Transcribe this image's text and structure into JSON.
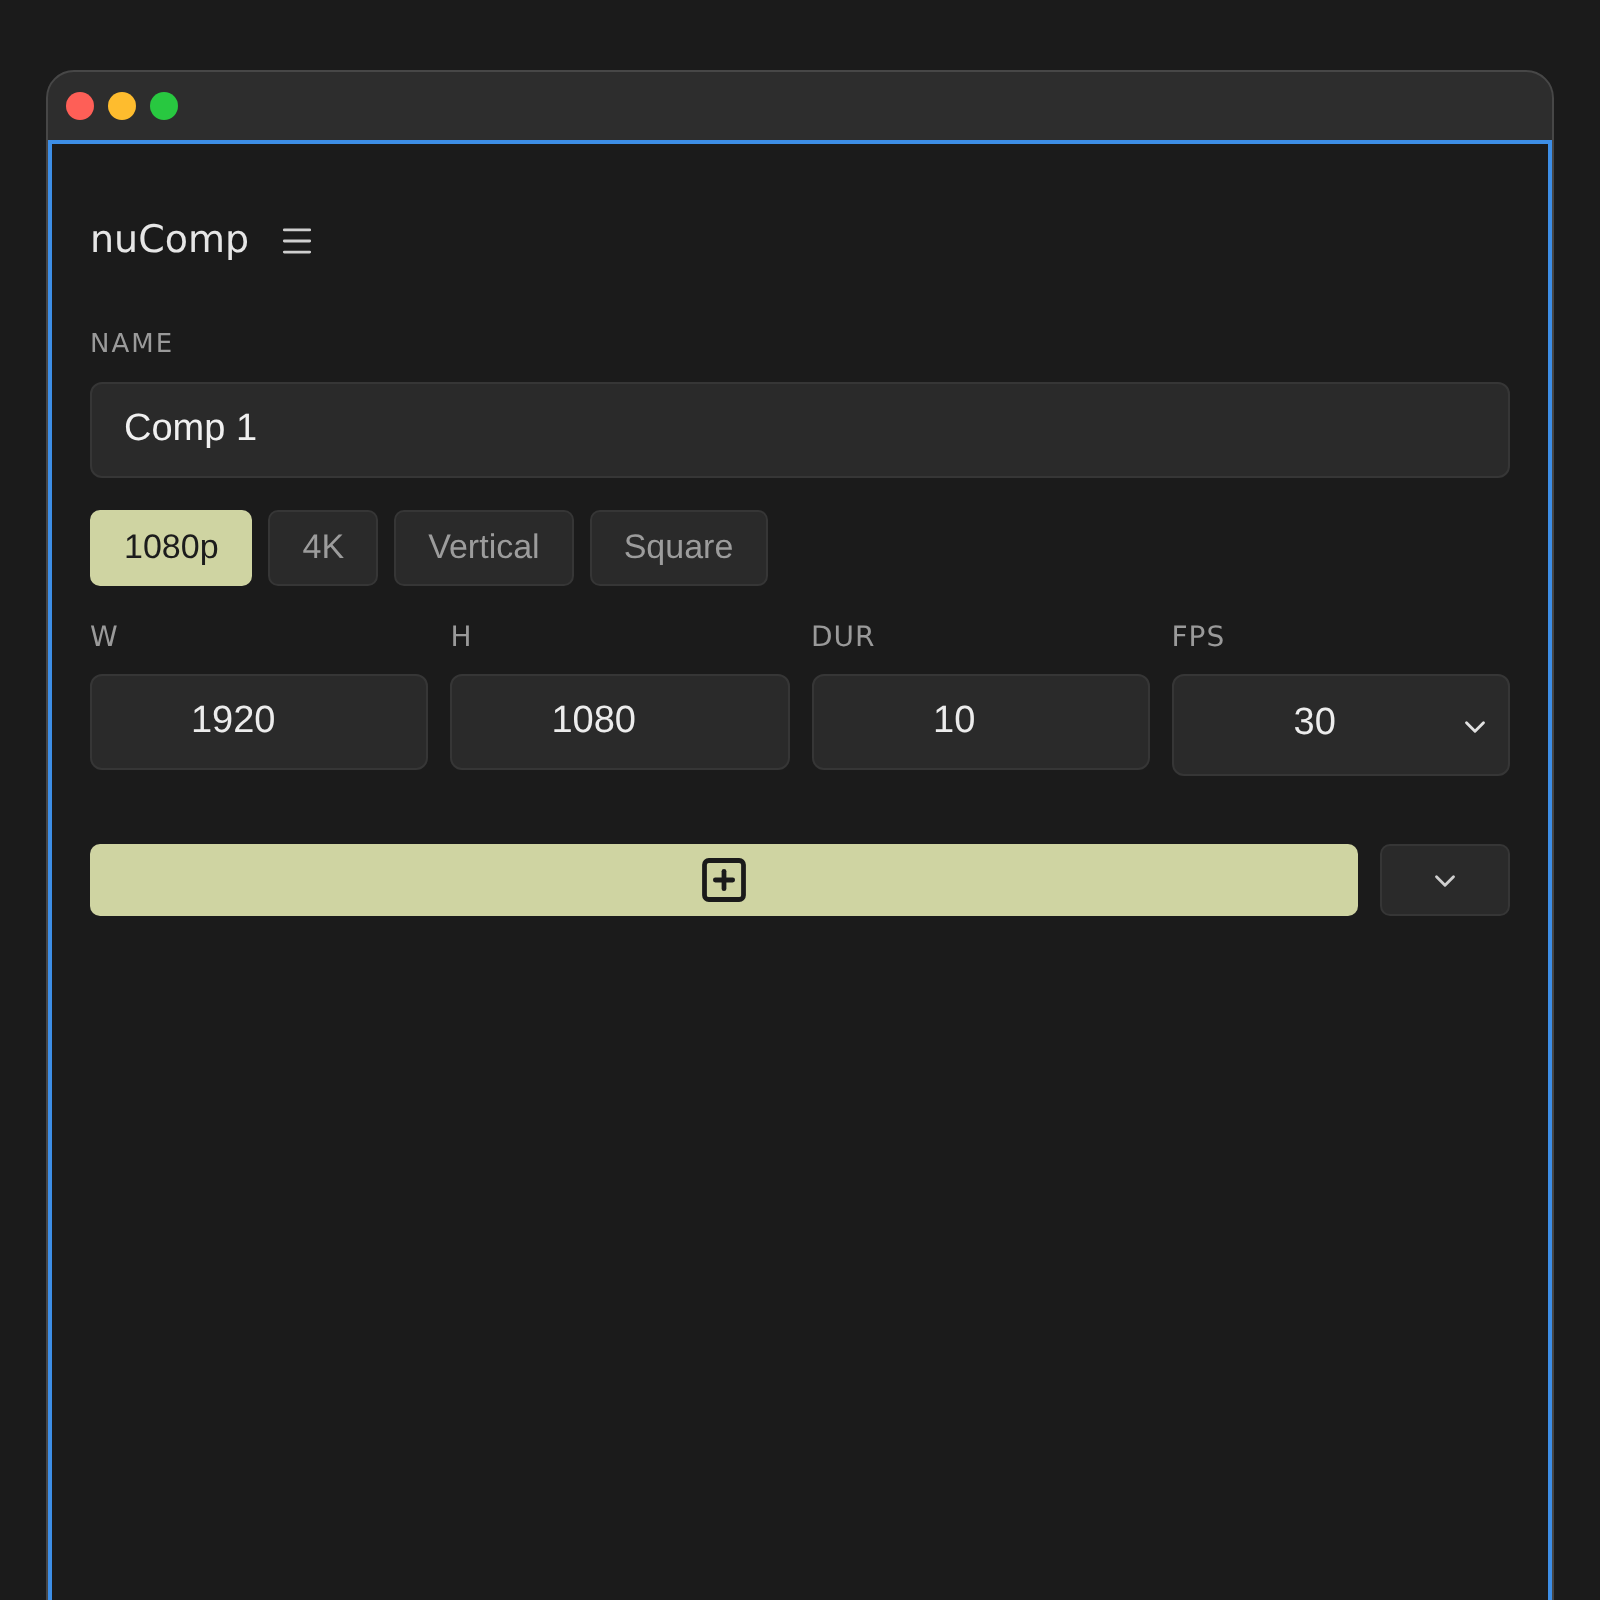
{
  "app": {
    "title": "nuComp"
  },
  "name_field": {
    "label": "NAME",
    "value": "Comp 1"
  },
  "presets": [
    {
      "label": "1080p",
      "selected": true
    },
    {
      "label": "4K",
      "selected": false
    },
    {
      "label": "Vertical",
      "selected": false
    },
    {
      "label": "Square",
      "selected": false
    }
  ],
  "fields": [
    {
      "label": "W",
      "value": "1920",
      "kind": "number"
    },
    {
      "label": "H",
      "value": "1080",
      "kind": "number"
    },
    {
      "label": "DUR",
      "value": "10",
      "kind": "number"
    },
    {
      "label": "FPS",
      "value": "30",
      "kind": "select"
    }
  ]
}
